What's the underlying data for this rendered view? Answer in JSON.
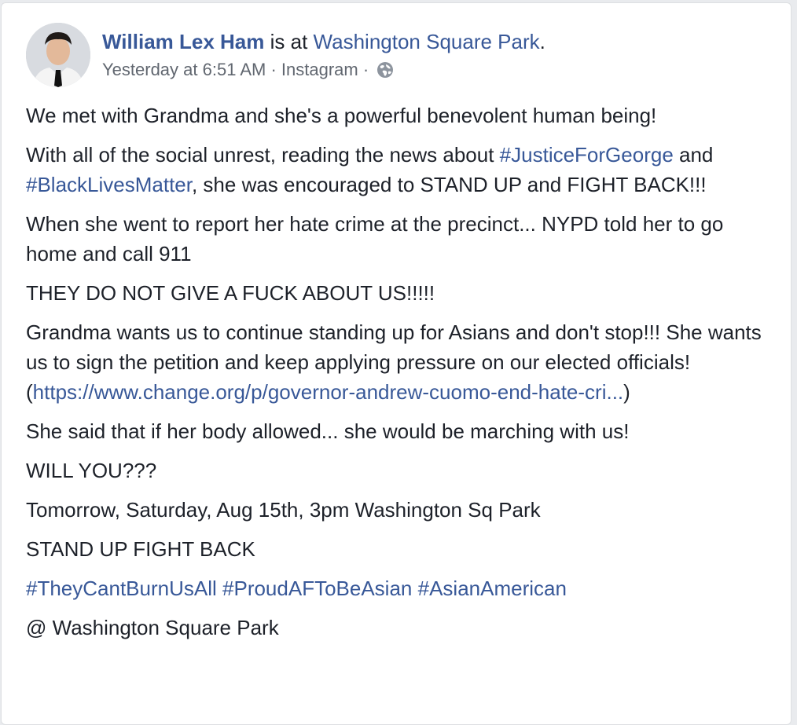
{
  "post": {
    "author": "William Lex Ham",
    "is_at": "is at",
    "location": "Washington Square Park",
    "location_suffix": ".",
    "timestamp": "Yesterday at 6:51 AM",
    "separator": " · ",
    "source": "Instagram",
    "separator2": " · ",
    "privacy_icon": "globe-icon",
    "paragraphs": {
      "p1": "We met with Grandma and she's a powerful benevolent human being!",
      "p2_a": "With all of the social unrest, reading the news about ",
      "p2_tag1": "#JusticeForGeorge",
      "p2_b": " and ",
      "p2_tag2": "#BlackLivesMatter",
      "p2_c": ", she was encouraged to STAND UP and FIGHT BACK!!!",
      "p3": "When she went to report her hate crime at the precinct... NYPD told her to go home and call 911",
      "p4": "THEY DO NOT GIVE A FUCK ABOUT US!!!!!",
      "p5_a": "Grandma wants us to continue standing up for Asians and don't stop!!! She wants us to sign the petition and keep applying pressure on our elected officials! (",
      "p5_url": "https://www.change.org/p/governor-andrew-cuomo-end-hate-cri...",
      "p5_b": ")",
      "p6": "She said that if her body allowed... she would be marching with us!",
      "p7": "WILL YOU???",
      "p8": "Tomorrow, Saturday, Aug 15th, 3pm Washington Sq Park",
      "p9": "STAND UP FIGHT BACK",
      "tag_1": "#TheyCantBurnUsAll",
      "tag_2": "#ProudAFToBeAsian",
      "tag_3": "#AsianAmerican",
      "p11": "@ Washington Square Park"
    }
  },
  "colors": {
    "link": "#385898",
    "text": "#1d2129",
    "meta": "#616770"
  }
}
